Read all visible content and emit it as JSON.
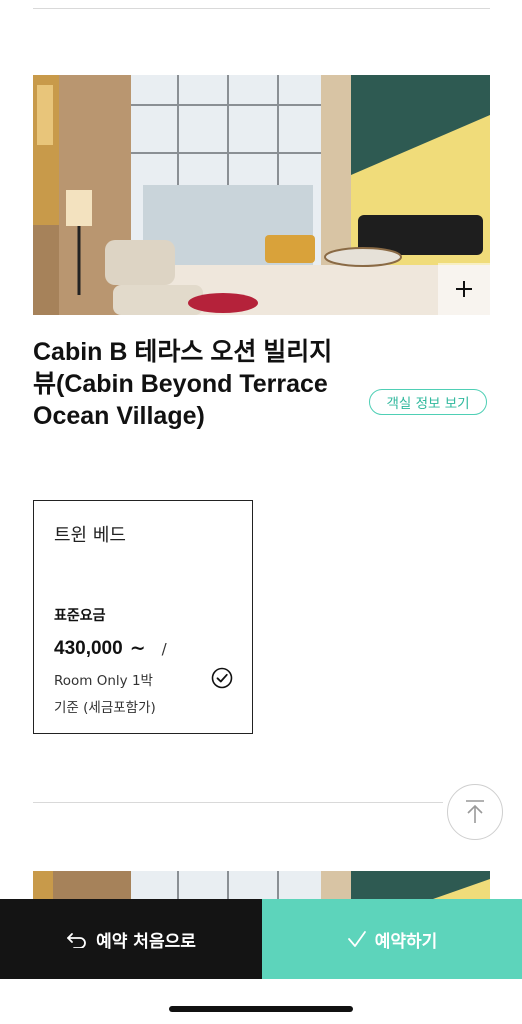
{
  "room": {
    "title": "Cabin B 테라스 오션 빌리지 뷰(Cabin Beyond Terrace Ocean Village)",
    "info_button_label": "객실 정보 보기",
    "expand_icon": "plus-icon"
  },
  "rate_card": {
    "bed_type": "트윈 베드",
    "rate_name": "표준요금",
    "price": "430,000",
    "price_suffix": "~",
    "separator": "/",
    "description_line1": "Room Only 1박",
    "description_line2": "기준 (세금포함가)",
    "selected": true,
    "check_icon": "check-circle-icon"
  },
  "scroll_top_icon": "arrow-up-icon",
  "bottom_bar": {
    "restart_label": "예약 처음으로",
    "restart_icon": "undo-arrow-icon",
    "book_label": "예약하기",
    "book_icon": "checkmark-icon"
  },
  "colors": {
    "accent": "#5dd4bb",
    "accent_text": "#2fb89d",
    "dark_button": "#141414"
  }
}
